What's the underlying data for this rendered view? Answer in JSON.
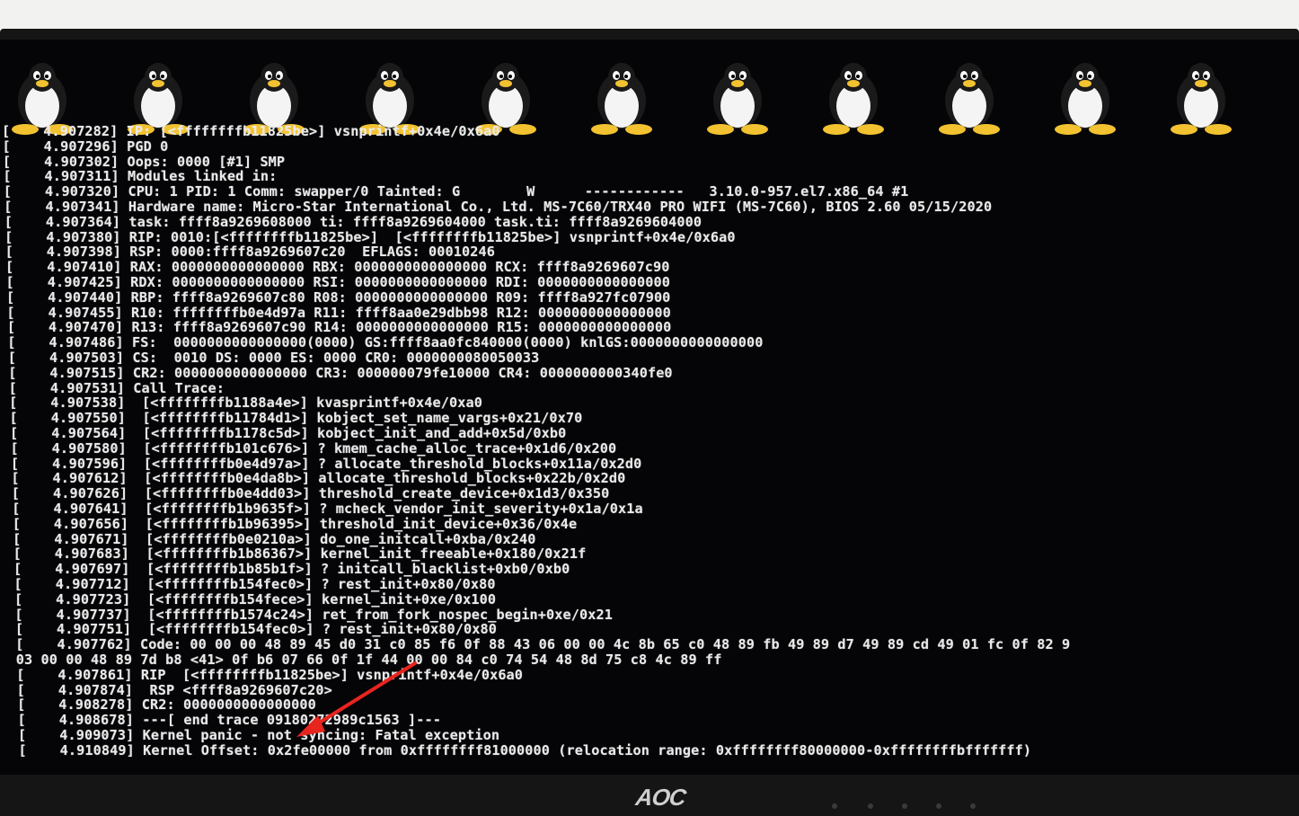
{
  "monitor": {
    "brand_label": "AOC"
  },
  "boot": {
    "logo_icon": "tux-penguin-icon",
    "logo_count": 11
  },
  "annotation": {
    "icon": "red-arrow-icon",
    "color": "#e8241e"
  },
  "console": {
    "lines": [
      "[    4.907282] IP: [<ffffffffb11825be>] vsnprintf+0x4e/0x6a0",
      "[    4.907296] PGD 0",
      "[    4.907302] Oops: 0000 [#1] SMP",
      "[    4.907311] Modules linked in:",
      "[    4.907320] CPU: 1 PID: 1 Comm: swapper/0 Tainted: G        W      ------------   3.10.0-957.el7.x86_64 #1",
      "[    4.907341] Hardware name: Micro-Star International Co., Ltd. MS-7C60/TRX40 PRO WIFI (MS-7C60), BIOS 2.60 05/15/2020",
      "[    4.907364] task: ffff8a9269608000 ti: ffff8a9269604000 task.ti: ffff8a9269604000",
      "[    4.907380] RIP: 0010:[<ffffffffb11825be>]  [<ffffffffb11825be>] vsnprintf+0x4e/0x6a0",
      "[    4.907398] RSP: 0000:ffff8a9269607c20  EFLAGS: 00010246",
      "[    4.907410] RAX: 0000000000000000 RBX: 0000000000000000 RCX: ffff8a9269607c90",
      "[    4.907425] RDX: 0000000000000000 RSI: 0000000000000000 RDI: 0000000000000000",
      "[    4.907440] RBP: ffff8a9269607c80 R08: 0000000000000000 R09: ffff8a927fc07900",
      "[    4.907455] R10: ffffffffb0e4d97a R11: ffff8aa0e29dbb98 R12: 0000000000000000",
      "[    4.907470] R13: ffff8a9269607c90 R14: 0000000000000000 R15: 0000000000000000",
      "[    4.907486] FS:  0000000000000000(0000) GS:ffff8aa0fc840000(0000) knlGS:0000000000000000",
      "[    4.907503] CS:  0010 DS: 0000 ES: 0000 CR0: 0000000080050033",
      "[    4.907515] CR2: 0000000000000000 CR3: 000000079fe10000 CR4: 0000000000340fe0",
      "[    4.907531] Call Trace:",
      "[    4.907538]  [<ffffffffb1188a4e>] kvasprintf+0x4e/0xa0",
      "[    4.907550]  [<ffffffffb11784d1>] kobject_set_name_vargs+0x21/0x70",
      "[    4.907564]  [<ffffffffb1178c5d>] kobject_init_and_add+0x5d/0xb0",
      "[    4.907580]  [<ffffffffb101c676>] ? kmem_cache_alloc_trace+0x1d6/0x200",
      "[    4.907596]  [<ffffffffb0e4d97a>] ? allocate_threshold_blocks+0x11a/0x2d0",
      "[    4.907612]  [<ffffffffb0e4da8b>] allocate_threshold_blocks+0x22b/0x2d0",
      "[    4.907626]  [<ffffffffb0e4dd03>] threshold_create_device+0x1d3/0x350",
      "[    4.907641]  [<ffffffffb1b9635f>] ? mcheck_vendor_init_severity+0x1a/0x1a",
      "[    4.907656]  [<ffffffffb1b96395>] threshold_init_device+0x36/0x4e",
      "[    4.907671]  [<ffffffffb0e0210a>] do_one_initcall+0xba/0x240",
      "[    4.907683]  [<ffffffffb1b86367>] kernel_init_freeable+0x180/0x21f",
      "[    4.907697]  [<ffffffffb1b85b1f>] ? initcall_blacklist+0xb0/0xb0",
      "[    4.907712]  [<ffffffffb154fec0>] ? rest_init+0x80/0x80",
      "[    4.907723]  [<ffffffffb154fece>] kernel_init+0xe/0x100",
      "[    4.907737]  [<ffffffffb1574c24>] ret_from_fork_nospec_begin+0xe/0x21",
      "[    4.907751]  [<ffffffffb154fec0>] ? rest_init+0x80/0x80",
      "[    4.907762] Code: 00 00 00 48 89 45 d0 31 c0 85 f6 0f 88 43 06 00 00 4c 8b 65 c0 48 89 fb 49 89 d7 49 89 cd 49 01 fc 0f 82 9",
      "03 00 00 48 89 7d b8 <41> 0f b6 07 66 0f 1f 44 00 00 84 c0 74 54 48 8d 75 c8 4c 89 ff",
      "[    4.907861] RIP  [<ffffffffb11825be>] vsnprintf+0x4e/0x6a0",
      "[    4.907874]  RSP <ffff8a9269607c20>",
      "[    4.908278] CR2: 0000000000000000",
      "[    4.908678] ---[ end trace 09180272989c1563 ]---",
      "[    4.909073] Kernel panic - not syncing: Fatal exception",
      "[    4.910849] Kernel Offset: 0x2fe00000 from 0xffffffff81000000 (relocation range: 0xffffffff80000000-0xffffffffbfffffff)"
    ]
  }
}
